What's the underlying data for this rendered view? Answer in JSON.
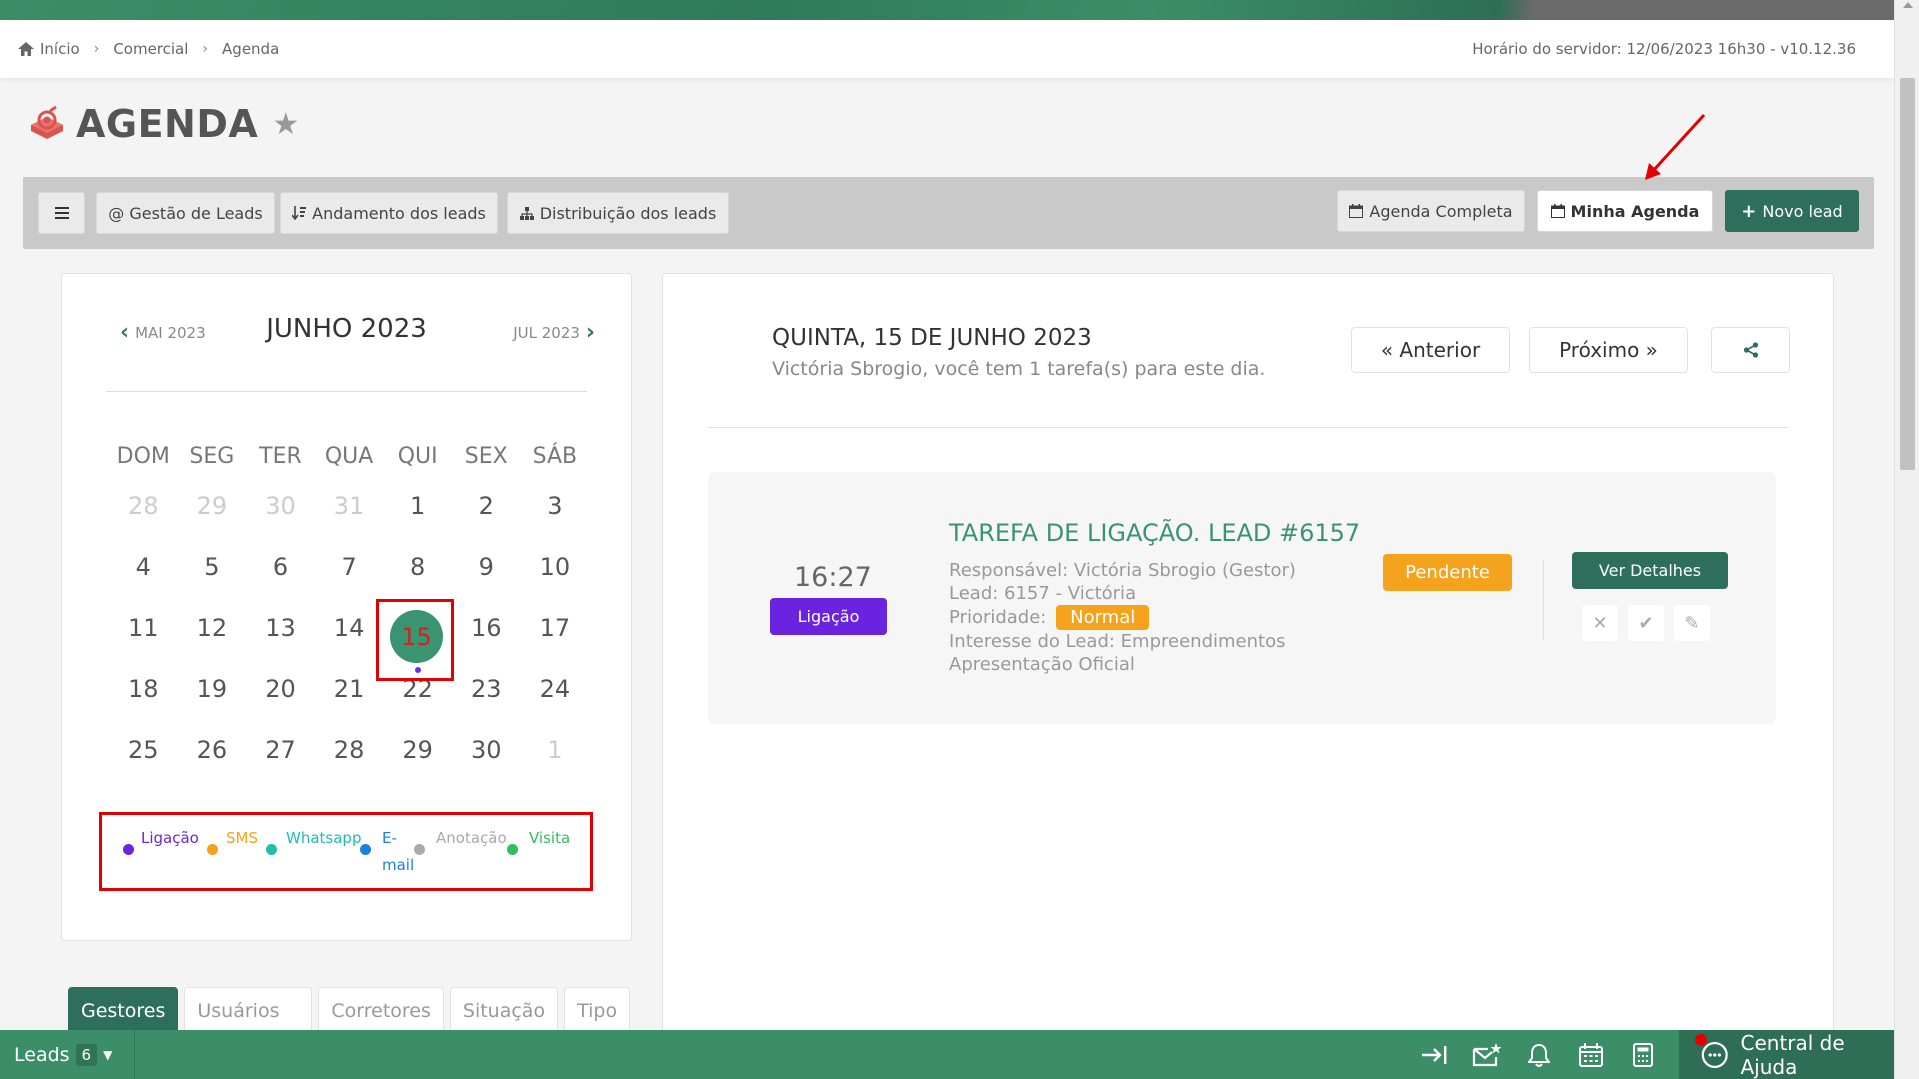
{
  "breadcrumb": {
    "home": "Início",
    "items": [
      "Comercial",
      "Agenda"
    ],
    "server_time": "Horário do servidor: 12/06/2023 16h30 - v10.12.36"
  },
  "page": {
    "title": "AGENDA"
  },
  "toolbar": {
    "gestao": "@ Gestão de Leads",
    "andamento": "Andamento dos leads",
    "distribuicao": "Distribuição dos leads",
    "agenda_completa": "Agenda Completa",
    "minha_agenda": "Minha Agenda",
    "novo_lead": "Novo lead"
  },
  "calendar": {
    "prev": "MAI 2023",
    "title": "JUNHO 2023",
    "next": "JUL 2023",
    "weekdays": [
      "DOM",
      "SEG",
      "TER",
      "QUA",
      "QUI",
      "SEX",
      "SÁB"
    ],
    "weeks": [
      [
        "28",
        "29",
        "30",
        "31",
        "1",
        "2",
        "3"
      ],
      [
        "4",
        "5",
        "6",
        "7",
        "8",
        "9",
        "10"
      ],
      [
        "11",
        "12",
        "13",
        "14",
        "15",
        "16",
        "17"
      ],
      [
        "18",
        "19",
        "20",
        "21",
        "22",
        "23",
        "24"
      ],
      [
        "25",
        "26",
        "27",
        "28",
        "29",
        "30",
        "1"
      ]
    ],
    "today": "15",
    "legend": {
      "ligacao": "Ligação",
      "sms": "SMS",
      "whatsapp": "Whatsapp",
      "email_1": "E-",
      "email_2": "mail",
      "anotacao": "Anotação",
      "visita": "Visita"
    },
    "legend_colors": {
      "ligacao": "#6a24e0",
      "sms": "#f5a21c",
      "whatsapp": "#1fbfae",
      "email": "#1a7fe0",
      "anotacao": "#aaaaaa",
      "visita": "#2fbf60"
    }
  },
  "tabs": [
    "Gestores",
    "Usuários",
    "Corretores",
    "Situação",
    "Tipo"
  ],
  "day": {
    "title": "QUINTA, 15 DE JUNHO 2023",
    "subtitle": "Victória Sbrogio, você tem 1 tarefa(s) para este dia.",
    "prev": "« Anterior",
    "next": "Próximo »"
  },
  "task": {
    "time": "16:27",
    "type": "Ligação",
    "title": "TAREFA DE LIGAÇÃO. LEAD #6157",
    "responsavel": "Responsável: Victória Sbrogio (Gestor)",
    "lead": "Lead: 6157 - Victória",
    "prioridade_label": "Prioridade:",
    "prioridade": "Normal",
    "interesse": "Interesse do Lead: Empreendimentos",
    "apresentacao": "Apresentação Oficial",
    "status": "Pendente",
    "details": "Ver Detalhes"
  },
  "bottom": {
    "leads": "Leads",
    "leads_count": "6",
    "help": "Central de Ajuda"
  }
}
